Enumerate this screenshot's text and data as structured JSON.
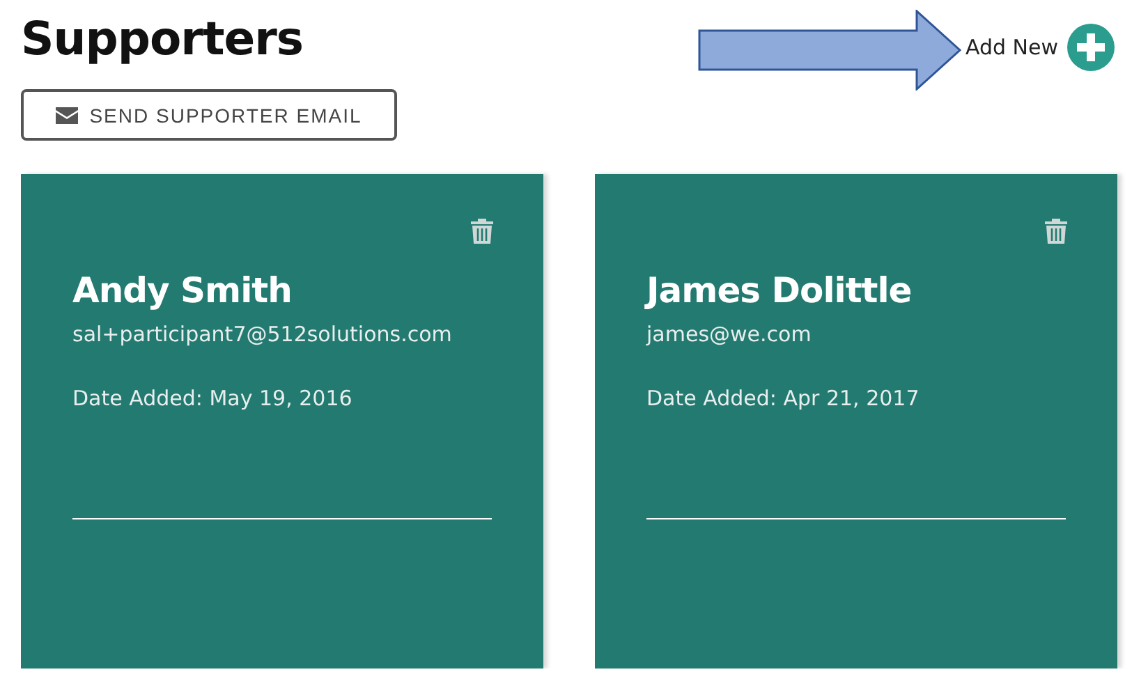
{
  "page": {
    "title": "Supporters",
    "add_new": {
      "label": "Add New"
    },
    "send_button": {
      "label": "SEND SUPPORTER EMAIL"
    }
  },
  "supporters": [
    {
      "name": "Andy Smith",
      "email": "sal+participant7@512solutions.com",
      "date_added": "Date Added: May 19, 2016"
    },
    {
      "name": "James Dolittle",
      "email": "james@we.com",
      "date_added": "Date Added: Apr 21, 2017"
    }
  ]
}
